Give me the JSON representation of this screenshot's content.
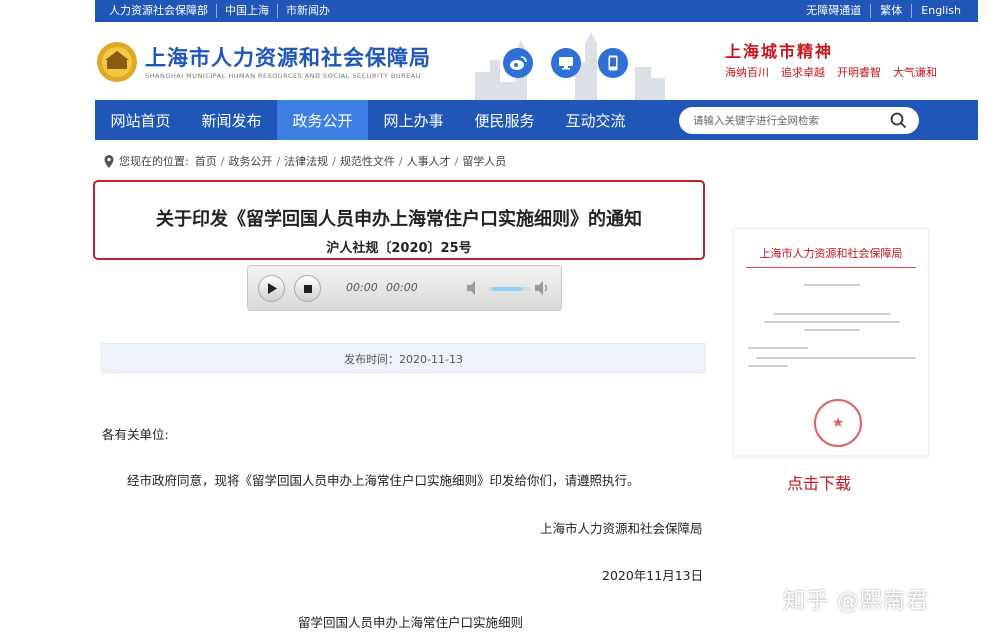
{
  "topbar": {
    "left": [
      "人力资源社会保障部",
      "中国上海",
      "市新闻办"
    ],
    "right": [
      "无障碍通道",
      "繁体",
      "English"
    ]
  },
  "header": {
    "site_name": "上海市人力资源和社会保障局",
    "site_name_en": "SHANGHAI MUNICIPAL HUMAN RESOURCES AND SOCIAL SECURITY BUREAU",
    "slogan_title": "上海城市精神",
    "slogan_items": [
      "海纳百川",
      "追求卓越",
      "开明睿智",
      "大气谦和"
    ],
    "social_icons": [
      "weibo-icon",
      "desktop-icon",
      "mobile-icon"
    ]
  },
  "nav": {
    "items": [
      "网站首页",
      "新闻发布",
      "政务公开",
      "网上办事",
      "便民服务",
      "互动交流"
    ],
    "active_index": 2,
    "search_placeholder": "请输入关键字进行全网检索"
  },
  "breadcrumb": {
    "label": "您现在的位置:",
    "items": [
      "首页",
      "政务公开",
      "法律法规",
      "规范性文件",
      "人事人才",
      "留学人员"
    ]
  },
  "article": {
    "title": "关于印发《留学回国人员申办上海常住户口实施细则》的通知",
    "doc_number": "沪人社规〔2020〕25号",
    "publish_time": "发布时间：2020-11-13",
    "salutation": "各有关单位:",
    "body": "经市政府同意，现将《留学回国人员申办上海常住户口实施细则》印发给你们，请遵照执行。",
    "signature": "上海市人力资源和社会保障局",
    "date": "2020年11月13日",
    "subtitle": "留学回国人员申办上海常住户口实施细则"
  },
  "player": {
    "current_time": "00:00",
    "duration": "00:00"
  },
  "preview": {
    "header": "上海市人力资源和社会保障局",
    "download_label": "点击下载"
  },
  "watermark": "知乎 @熙南君",
  "colors": {
    "nav_blue": "#1f56b8",
    "nav_active": "#3f7ee3",
    "accent_red": "#c4161c"
  }
}
